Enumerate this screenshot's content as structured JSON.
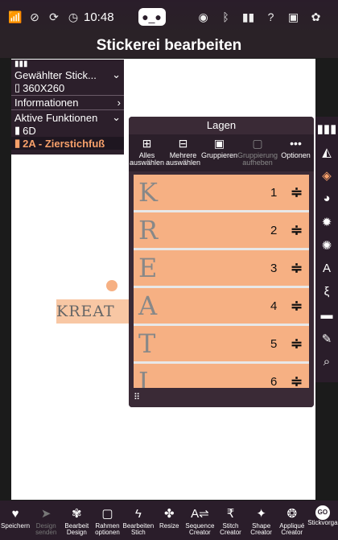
{
  "status": {
    "time": "10:48",
    "icons_left": [
      "wifi-icon",
      "notification-off-icon",
      "sync-icon",
      "clock-icon"
    ],
    "icons_right": [
      "robot-icon",
      "rss-icon",
      "bluetooth-icon",
      "book-icon",
      "help-icon",
      "save-icon",
      "settings-icon"
    ]
  },
  "header": {
    "title": "Stickerei bearbeiten"
  },
  "left_panel": {
    "selected_label": "Gewählter Stick...",
    "size": "360X260",
    "info_label": "Informationen",
    "active_label": "Aktive Funktionen",
    "func1": "6D",
    "func2": "2A - Zierstichfuß"
  },
  "layers_panel": {
    "title": "Lagen",
    "tools": [
      {
        "label": "Alles auswählen",
        "icon": "select-all-icon",
        "enabled": true
      },
      {
        "label": "Mehrere auswählen",
        "icon": "multi-select-icon",
        "enabled": true
      },
      {
        "label": "Gruppieren",
        "icon": "group-icon",
        "enabled": true
      },
      {
        "label": "Gruppierung aufheben",
        "icon": "ungroup-icon",
        "enabled": false
      },
      {
        "label": "Optionen",
        "icon": "more-icon",
        "enabled": true
      }
    ],
    "rows": [
      {
        "letter": "K",
        "number": "1"
      },
      {
        "letter": "R",
        "number": "2"
      },
      {
        "letter": "E",
        "number": "3"
      },
      {
        "letter": "A",
        "number": "4"
      },
      {
        "letter": "T",
        "number": "5"
      },
      {
        "letter": "I",
        "number": "6"
      }
    ]
  },
  "canvas": {
    "stitch_text": "KREAT"
  },
  "bottom": {
    "items": [
      {
        "label": "Speichern",
        "icon": "heart-icon",
        "enabled": true
      },
      {
        "label": "Design senden",
        "icon": "send-icon",
        "enabled": false
      },
      {
        "label": "Bearbeit Design",
        "icon": "edit-design-icon",
        "enabled": true
      },
      {
        "label": "Rahmen optionen",
        "icon": "hoop-icon",
        "enabled": true
      },
      {
        "label": "Bearbeiten Stich",
        "icon": "edit-stitch-icon",
        "enabled": true
      },
      {
        "label": "Resize",
        "icon": "resize-icon",
        "enabled": true
      },
      {
        "label": "Sequence Creator",
        "icon": "sequence-icon",
        "enabled": true
      },
      {
        "label": "Stitch Creator",
        "icon": "stitch-creator-icon",
        "enabled": true
      },
      {
        "label": "Shape Creator",
        "icon": "shape-icon",
        "enabled": true
      },
      {
        "label": "Appliqué Creator",
        "icon": "applique-icon",
        "enabled": true
      },
      {
        "label": "Stickvorga",
        "icon": "go-icon",
        "enabled": true
      }
    ]
  }
}
